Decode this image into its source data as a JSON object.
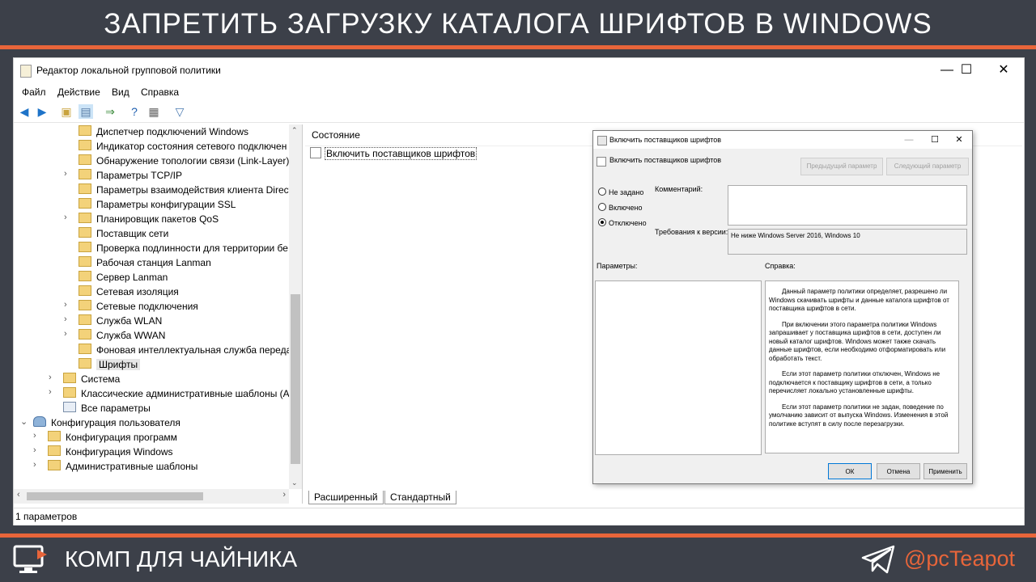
{
  "banner": {
    "title": "ЗАПРЕТИТЬ ЗАГРУЗКУ КАТАЛОГА ШРИФТОВ В WINDOWS"
  },
  "window": {
    "title": "Редактор локальной групповой политики",
    "controls": {
      "minimize": "—",
      "maximize": "☐",
      "close": "✕"
    }
  },
  "menu": [
    "Файл",
    "Действие",
    "Вид",
    "Справка"
  ],
  "tree": [
    {
      "label": "Диспетчер подключений Windows",
      "level": 3,
      "expander": false
    },
    {
      "label": "Индикатор состояния сетевого подключен",
      "level": 3,
      "expander": false
    },
    {
      "label": "Обнаружение топологии связи (Link-Layer)",
      "level": 3,
      "expander": false
    },
    {
      "label": "Параметры TCP/IP",
      "level": 3,
      "expander": true
    },
    {
      "label": "Параметры взаимодействия клиента Direct",
      "level": 3,
      "expander": false
    },
    {
      "label": "Параметры конфигурации SSL",
      "level": 3,
      "expander": false
    },
    {
      "label": "Планировщик пакетов QoS",
      "level": 3,
      "expander": true
    },
    {
      "label": "Поставщик сети",
      "level": 3,
      "expander": false
    },
    {
      "label": "Проверка подлинности для территории бе",
      "level": 3,
      "expander": false
    },
    {
      "label": "Рабочая станция Lanman",
      "level": 3,
      "expander": false
    },
    {
      "label": "Сервер Lanman",
      "level": 3,
      "expander": false
    },
    {
      "label": "Сетевая изоляция",
      "level": 3,
      "expander": false
    },
    {
      "label": "Сетевые подключения",
      "level": 3,
      "expander": true
    },
    {
      "label": "Служба WLAN",
      "level": 3,
      "expander": true
    },
    {
      "label": "Служба WWAN",
      "level": 3,
      "expander": true
    },
    {
      "label": "Фоновая интеллектуальная служба переда",
      "level": 3,
      "expander": false
    },
    {
      "label": "Шрифты",
      "level": 3,
      "expander": false,
      "selected": true
    },
    {
      "label": "Система",
      "level": 2,
      "expander": true
    },
    {
      "label": "Классические административные шаблоны (А",
      "level": 2,
      "expander": true
    },
    {
      "label": "Все параметры",
      "level": 2,
      "expander": false,
      "icon": "settings"
    },
    {
      "label": "Конфигурация пользователя",
      "level": 0,
      "expander": true,
      "expanded": true,
      "icon": "user"
    },
    {
      "label": "Конфигурация программ",
      "level": 1,
      "expander": true
    },
    {
      "label": "Конфигурация Windows",
      "level": 1,
      "expander": true
    },
    {
      "label": "Административные шаблоны",
      "level": 1,
      "expander": true
    }
  ],
  "list": {
    "column_header": "Состояние",
    "policy": "Включить поставщиков шрифтов"
  },
  "tabs": [
    "Расширенный",
    "Стандартный"
  ],
  "status": {
    "text": "1 параметров"
  },
  "dialog": {
    "title": "Включить поставщиков шрифтов",
    "policy_name": "Включить поставщиков шрифтов",
    "prev_button": "Предыдущий параметр",
    "next_button": "Следующий параметр",
    "radios": [
      {
        "label": "Не задано",
        "checked": false
      },
      {
        "label": "Включено",
        "checked": false
      },
      {
        "label": "Отключено",
        "checked": true
      }
    ],
    "comment_label": "Комментарий:",
    "requirements_label": "Требования к версии:",
    "requirements_value": "Не ниже Windows Server 2016, Windows 10",
    "params_label": "Параметры:",
    "help_label": "Справка:",
    "help": [
      "Данный параметр политики определяет, разрешено ли Windows скачивать шрифты и данные каталога шрифтов от поставщика шрифтов в сети.",
      "При включении этого параметра политики Windows запрашивает у поставщика шрифтов в сети, доступен ли новый каталог шрифтов. Windows может также скачать данные шрифтов, если необходимо отформатировать или обработать текст.",
      "Если этот параметр политики отключен, Windows не подключается к поставщику шрифтов в сети, а только перечисляет локально установленные шрифты.",
      "Если этот параметр политики не задан, поведение по умолчанию зависит от выпуска Windows. Изменения в этой политике вступят в силу после перезагрузки."
    ],
    "ok": "ОК",
    "cancel": "Отмена",
    "apply": "Применить"
  },
  "footer": {
    "brand": "КОМП ДЛЯ ЧАЙНИКА",
    "handle": "@pcTeapot"
  },
  "colors": {
    "accent": "#e8653a",
    "band": "#3c4049"
  }
}
